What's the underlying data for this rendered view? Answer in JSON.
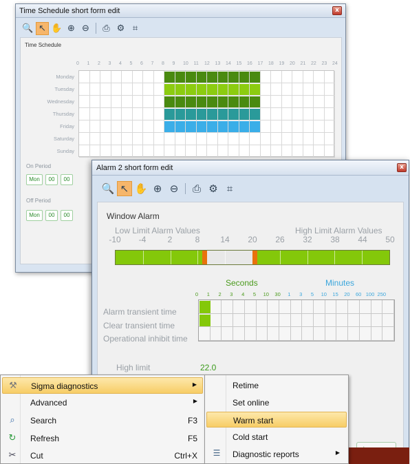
{
  "win1": {
    "title": "Time Schedule short form edit",
    "close_label": "x",
    "header": "Time Schedule",
    "hours": [
      "0",
      "1",
      "2",
      "3",
      "4",
      "5",
      "6",
      "7",
      "8",
      "9",
      "10",
      "11",
      "12",
      "13",
      "14",
      "15",
      "16",
      "17",
      "18",
      "19",
      "20",
      "21",
      "22",
      "23",
      "24"
    ],
    "days": [
      "Monday",
      "Tuesday",
      "Wednesday",
      "Thursday",
      "Friday",
      "Saturday",
      "Sunday"
    ],
    "schedule": [
      {
        "day": "Monday",
        "start": 8,
        "end": 17,
        "color": "#4a8a10"
      },
      {
        "day": "Tuesday",
        "start": 8,
        "end": 17,
        "color": "#8ccc10"
      },
      {
        "day": "Wednesday",
        "start": 8,
        "end": 17,
        "color": "#4a8a10"
      },
      {
        "day": "Thursday",
        "start": 8,
        "end": 17,
        "color": "#2a9a9a"
      },
      {
        "day": "Friday",
        "start": 8,
        "end": 17,
        "color": "#3aaee8"
      }
    ],
    "on_period": {
      "label": "On Period",
      "chips": [
        "Mon",
        "00",
        "00"
      ]
    },
    "off_period": {
      "label": "Off Period",
      "chips": [
        "Mon",
        "00",
        "00"
      ]
    }
  },
  "win2": {
    "title": "Alarm 2 short form edit",
    "close_label": "x",
    "heading": "Window Alarm",
    "low_limit_label": "Low Limit Alarm Values",
    "high_limit_label": "High Limit Alarm Values",
    "scale": [
      "-10",
      "-4",
      "2",
      "8",
      "14",
      "20",
      "26",
      "32",
      "38",
      "44",
      "50"
    ],
    "seconds_label": "Seconds",
    "minutes_label": "Minutes",
    "seconds_ticks": [
      "0",
      "1",
      "2",
      "3",
      "4",
      "5",
      "10",
      "30"
    ],
    "minutes_ticks": [
      "1",
      "3",
      "5",
      "10",
      "15",
      "20",
      "60",
      "100",
      "250"
    ],
    "rows": [
      "Alarm transient time",
      "Clear transient time",
      "Operational inhibit time"
    ],
    "high_limit_label_short": "High limit",
    "high_limit_value": "22.0",
    "changes_button": "hanges"
  },
  "menu1": {
    "items": [
      {
        "label": "Sigma diagnostics",
        "shortcut": "",
        "submenu": true,
        "icon": "tools-icon"
      },
      {
        "label": "Advanced",
        "shortcut": "",
        "submenu": true,
        "icon": ""
      },
      {
        "label": "Search",
        "shortcut": "F3",
        "submenu": false,
        "icon": "search-icon"
      },
      {
        "label": "Refresh",
        "shortcut": "F5",
        "submenu": false,
        "icon": "refresh-icon"
      },
      {
        "label": "Cut",
        "shortcut": "Ctrl+X",
        "submenu": false,
        "icon": "scissors-icon"
      }
    ]
  },
  "menu2": {
    "items": [
      {
        "label": "Retime",
        "submenu": false
      },
      {
        "label": "Set online",
        "submenu": false
      },
      {
        "label": "Warm start",
        "submenu": false
      },
      {
        "label": "Cold start",
        "submenu": false
      },
      {
        "label": "Diagnostic reports",
        "submenu": true
      }
    ]
  },
  "colors": {
    "green_dark": "#4a8a10",
    "green_light": "#8ccc10",
    "teal": "#2a9a9a",
    "blue": "#3aaee8",
    "alarm_orange": "#e8720c",
    "menu_highlight": "#f7cd66"
  }
}
